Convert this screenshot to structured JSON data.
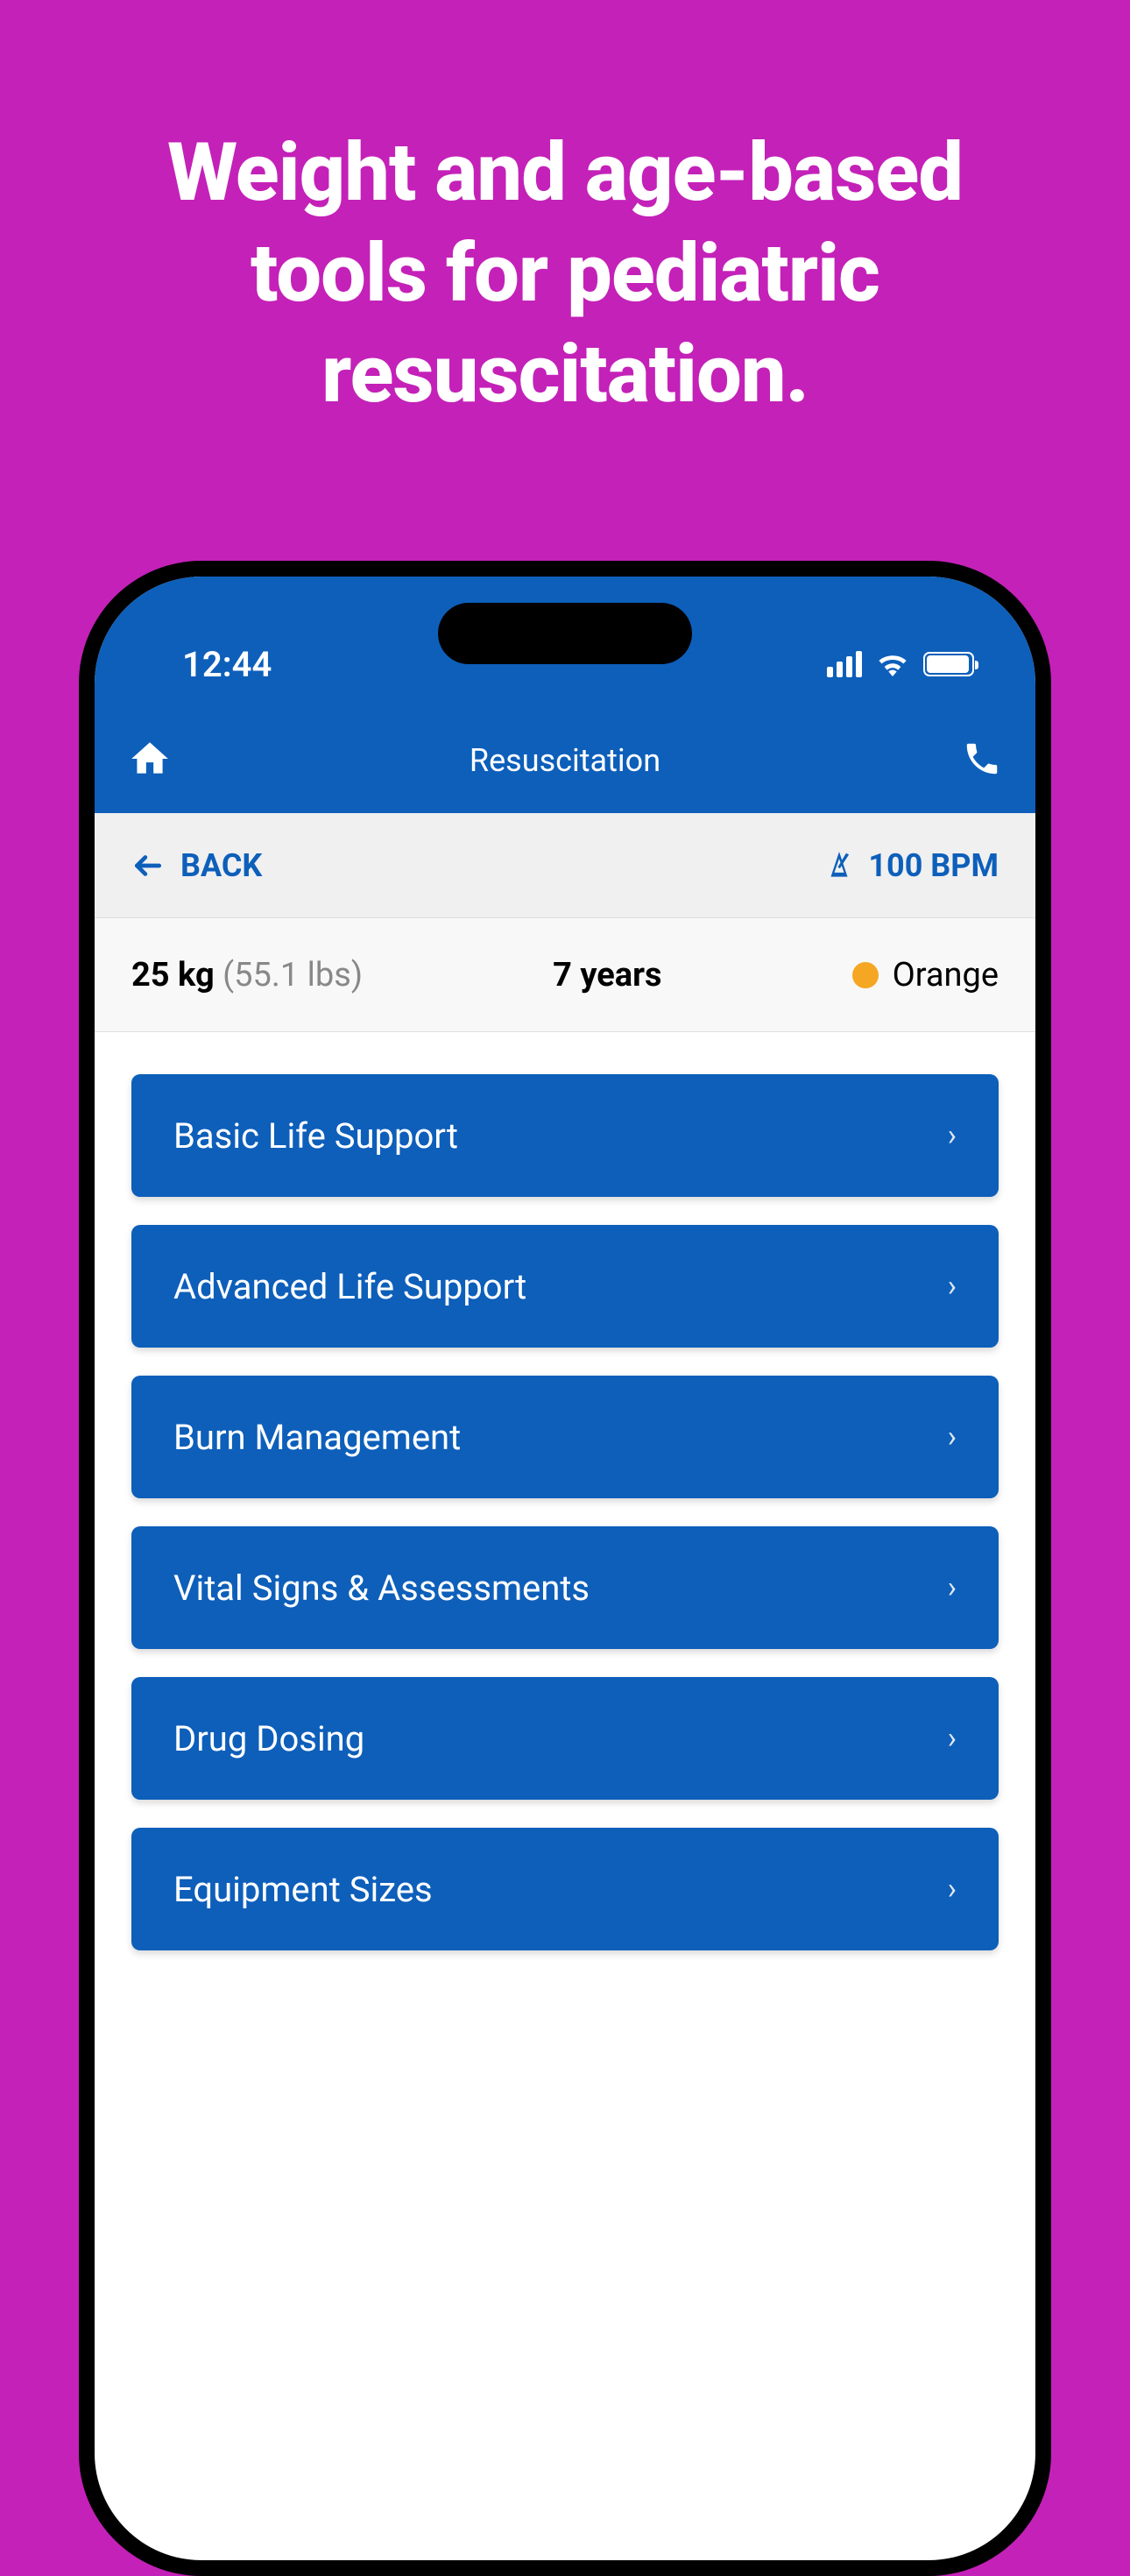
{
  "promo": {
    "title": "Weight and age-based tools for pediatric resuscitation."
  },
  "status": {
    "time": "12:44"
  },
  "header": {
    "title": "Resuscitation"
  },
  "toolbar": {
    "back_label": "BACK",
    "bpm_label": "100 BPM"
  },
  "patient": {
    "weight_kg": "25 kg",
    "weight_lbs": "(55.1 lbs)",
    "age": "7 years",
    "zone_label": "Orange",
    "zone_color": "#f5a623"
  },
  "menu": {
    "items": [
      {
        "label": "Basic Life Support"
      },
      {
        "label": "Advanced Life Support"
      },
      {
        "label": "Burn Management"
      },
      {
        "label": "Vital Signs & Assessments"
      },
      {
        "label": "Drug Dosing"
      },
      {
        "label": "Equipment Sizes"
      }
    ]
  },
  "colors": {
    "brand_blue": "#0d5fba",
    "background_magenta": "#c421b8"
  }
}
